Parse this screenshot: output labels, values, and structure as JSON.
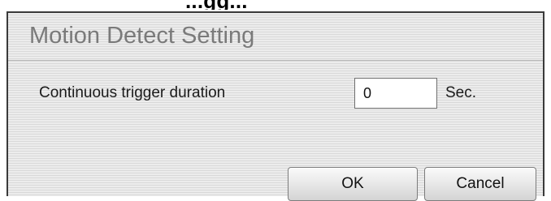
{
  "background_heading": {
    "partial_text": "...gg..."
  },
  "dialog": {
    "title": "Motion Detect Setting",
    "field": {
      "label": "Continuous trigger duration",
      "value": "0",
      "unit": "Sec."
    },
    "buttons": {
      "ok_label": "OK",
      "cancel_label": "Cancel"
    }
  },
  "colors": {
    "title_text": "#7a7a7a",
    "dialog_bg": "#e6e6e6",
    "border": "#3a3a3a"
  }
}
